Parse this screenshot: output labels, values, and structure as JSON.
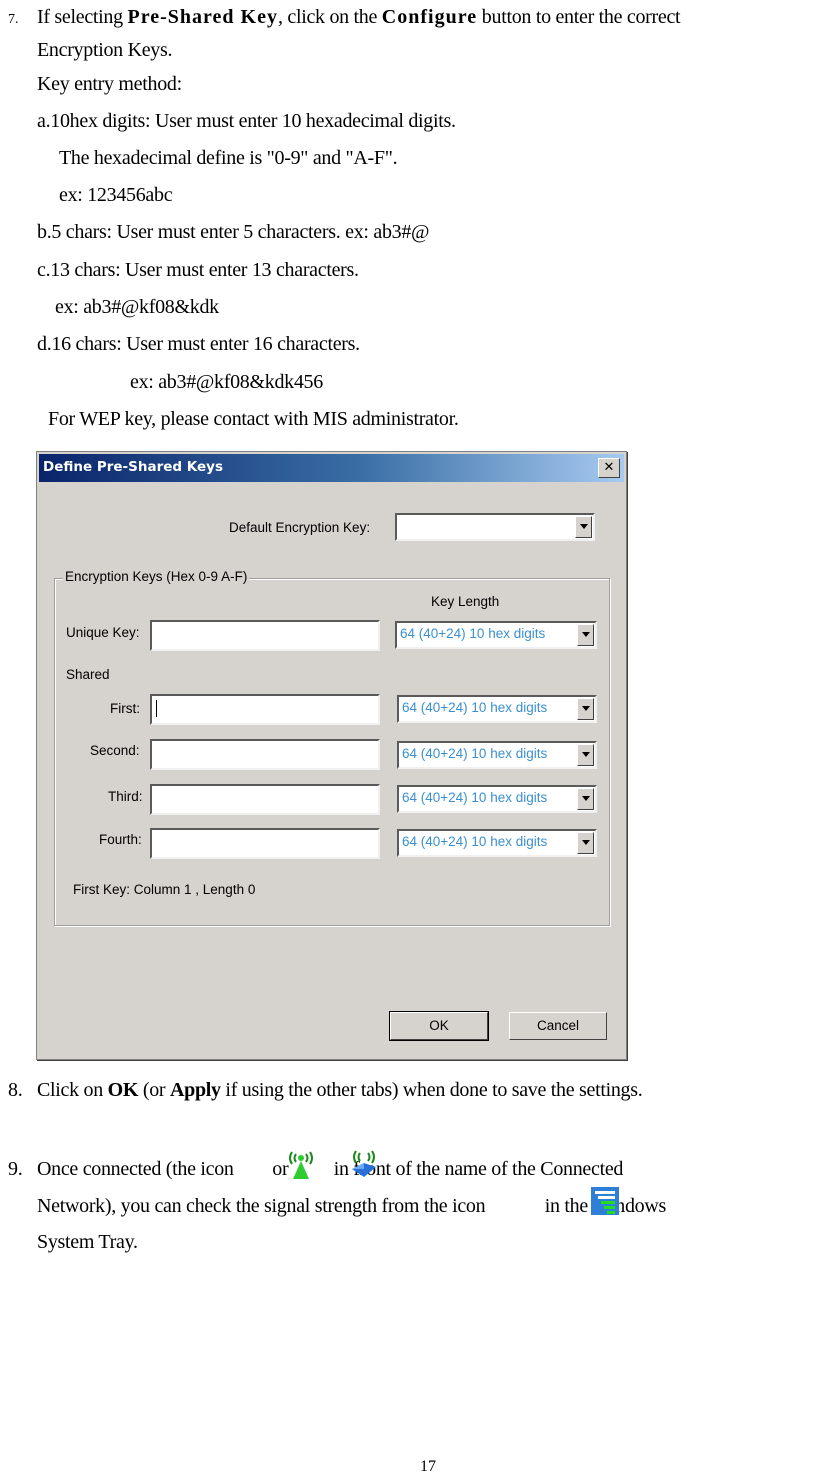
{
  "step7": {
    "number": "7.",
    "line1_pre": "If selecting ",
    "line1_bold1": "Pre-Shared Key",
    "line1_mid": ", click on the ",
    "line1_bold2": "Configure",
    "line1_post": " button to enter the correct",
    "line2": "Encryption Keys.",
    "line3": "Key entry method:",
    "a_line1": "a.10hex digits: User must enter 10 hexadecimal digits.",
    "a_line2": "The hexadecimal define is \"0-9\" and \"A-F\".",
    "a_line3": "ex: 123456abc",
    "b_line": "b.5 chars: User must enter 5 characters. ex: ab3#@",
    "c_line1": "c.13 chars: User must enter 13 characters.",
    "c_line2": "ex: ab3#@kf08&kdk",
    "d_line1": "d.16 chars: User must enter 16 characters.",
    "d_line2": "ex: ab3#@kf08&kdk456",
    "wep_note": "For WEP key, please contact with MIS administrator."
  },
  "dialog": {
    "title": "Define Pre-Shared Keys",
    "close_glyph": "✕",
    "default_key_label": "Default Encryption Key:",
    "default_key_value": "",
    "group_legend": "Encryption Keys (Hex 0-9 A-F)",
    "key_length_header": "Key Length",
    "unique_key_label": "Unique Key:",
    "shared_label": "Shared",
    "rows": [
      {
        "label": "Unique Key:",
        "value": "",
        "length": "64  (40+24)  10 hex digits"
      },
      {
        "label": "First:",
        "value": "",
        "length": "64  (40+24)  10 hex digits"
      },
      {
        "label": "Second:",
        "value": "",
        "length": "64  (40+24)  10 hex digits"
      },
      {
        "label": "Third:",
        "value": "",
        "length": "64  (40+24)  10 hex digits"
      },
      {
        "label": "Fourth:",
        "value": "",
        "length": "64  (40+24)  10 hex digits"
      }
    ],
    "status": "First Key: Column 1 ,  Length 0",
    "ok_label": "OK",
    "cancel_label": "Cancel"
  },
  "step8": {
    "number": "8.",
    "pre": "Click on ",
    "bold1": "OK",
    "mid": " (or ",
    "bold2": "Apply",
    "post": " if using the other tabs) when done to save the settings."
  },
  "step9": {
    "number": "9.",
    "line1_pre": "Once connected (the icon ",
    "line1_or": "or ",
    "line1_post": " in front of the name of the Connected",
    "line2_pre": "Network), you can check the signal strength from the icon ",
    "line2_post": " in the Windows",
    "line3": "System Tray.",
    "icons": [
      "antenna-connected-icon",
      "antenna-infrastructure-icon",
      "signal-strength-tray-icon"
    ]
  },
  "page_number": "17"
}
